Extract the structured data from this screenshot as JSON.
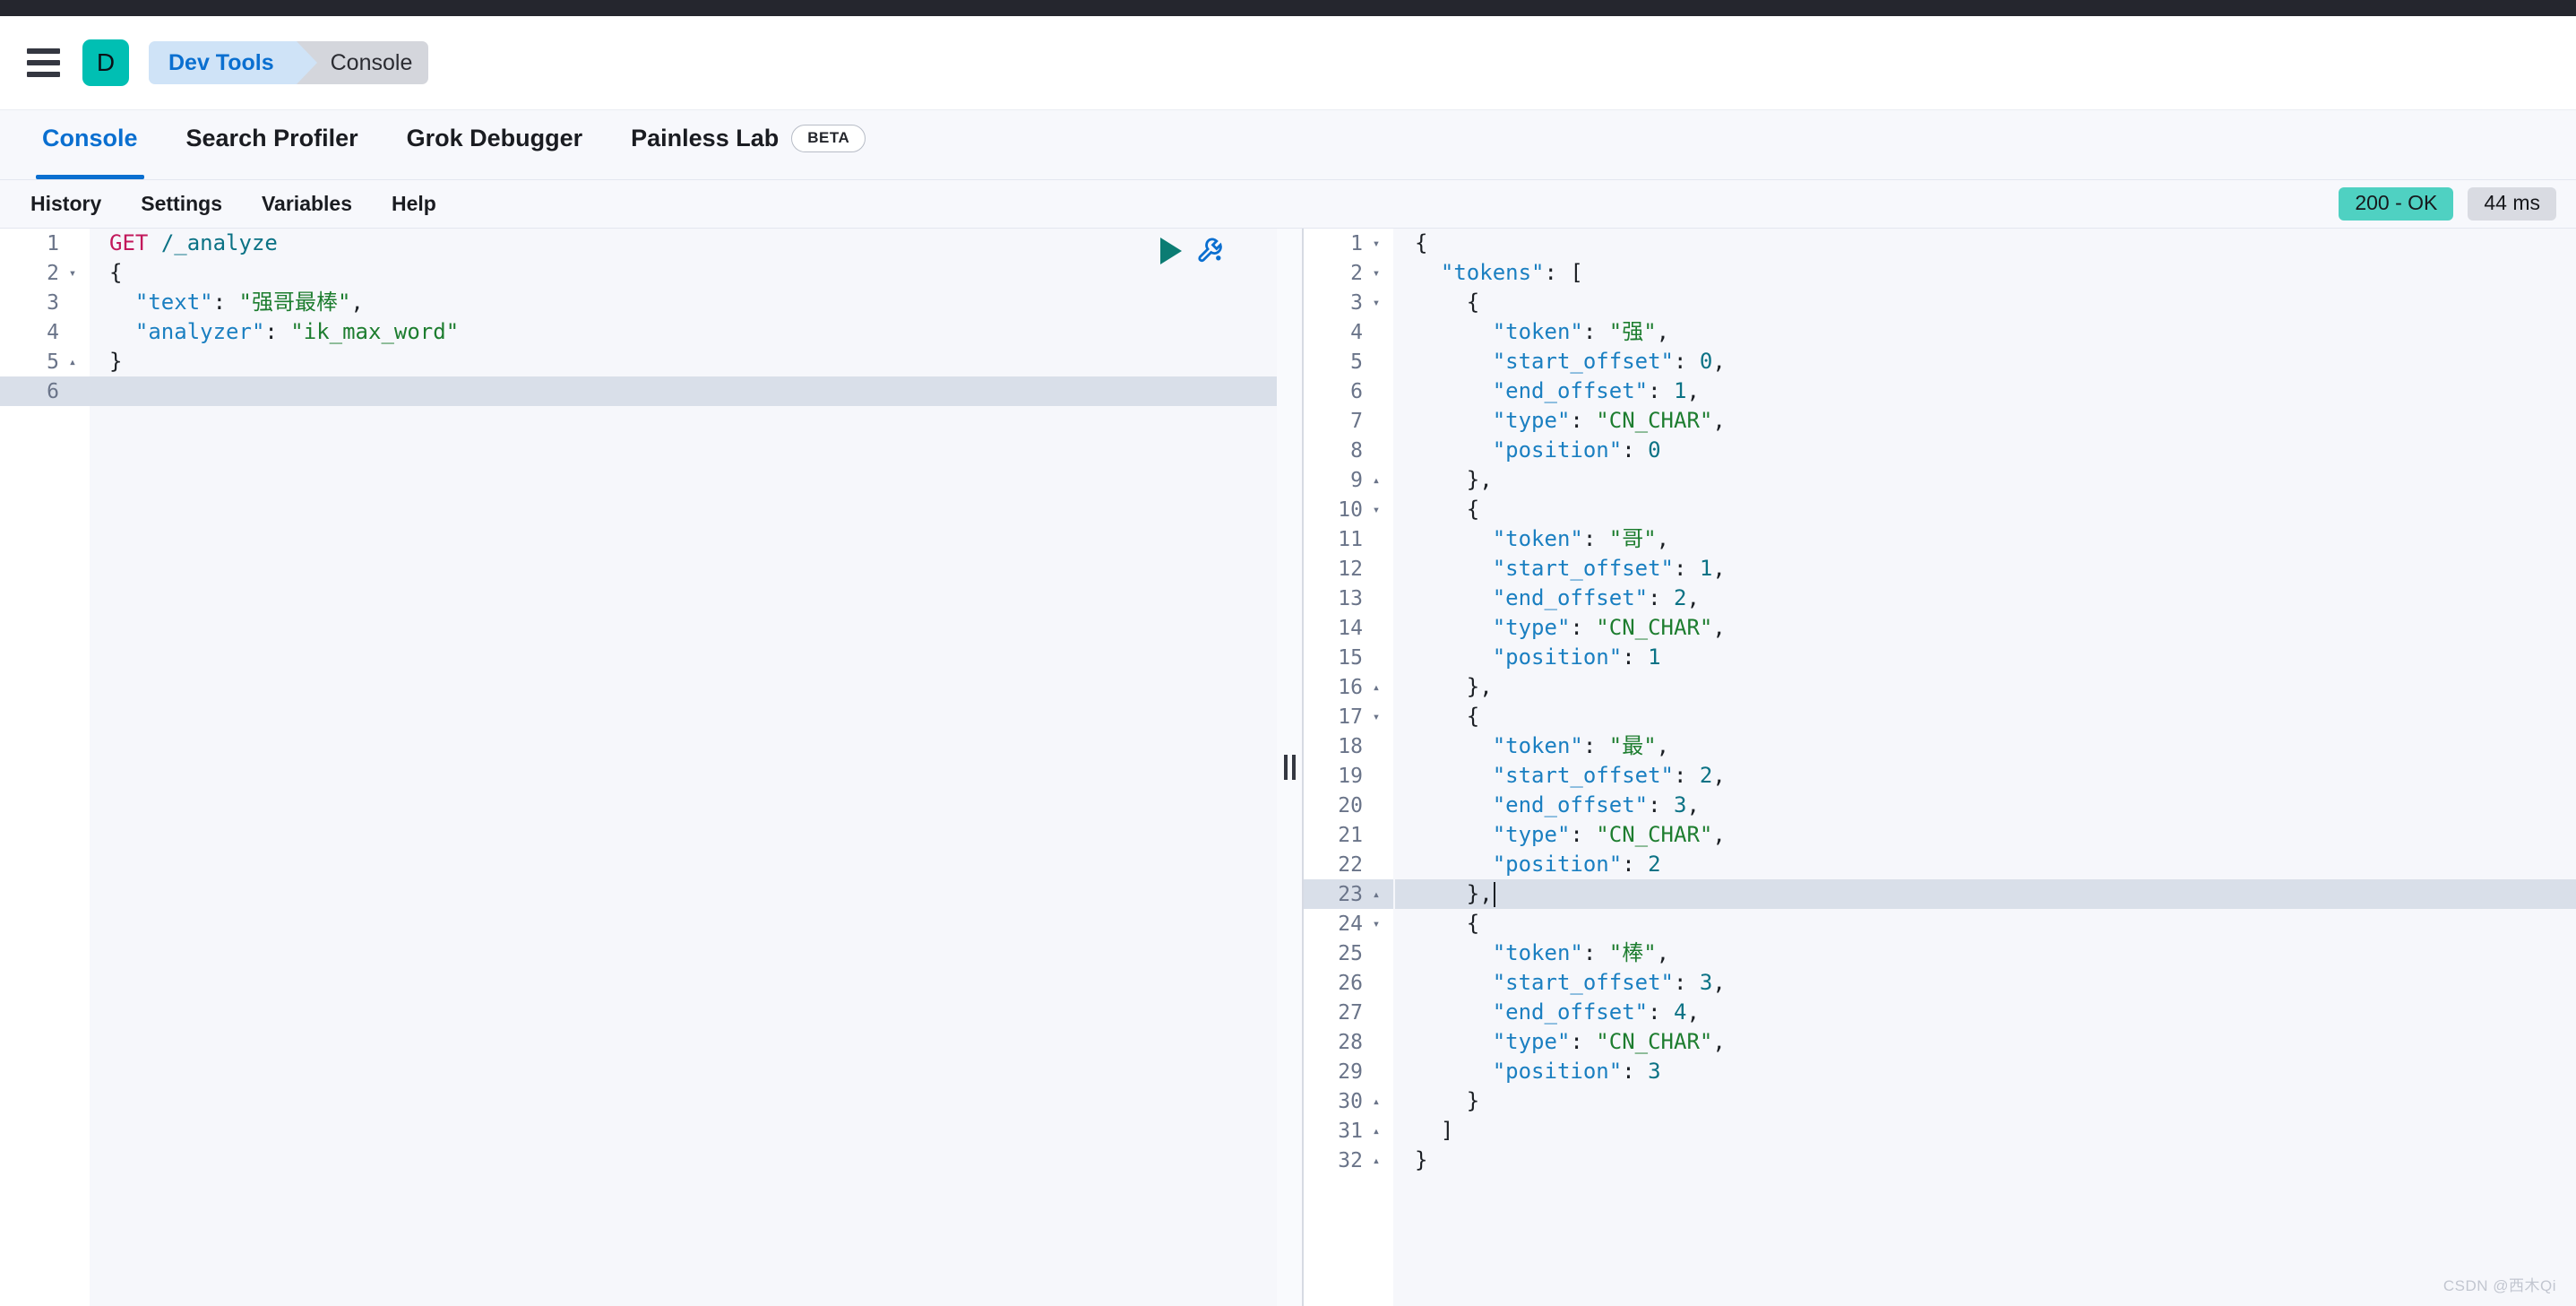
{
  "header": {
    "menu_icon": "hamburger-icon",
    "space_initial": "D",
    "breadcrumbs": [
      "Dev Tools",
      "Console"
    ]
  },
  "app_tabs": [
    {
      "label": "Console",
      "active": true,
      "badge": null
    },
    {
      "label": "Search Profiler",
      "active": false,
      "badge": null
    },
    {
      "label": "Grok Debugger",
      "active": false,
      "badge": null
    },
    {
      "label": "Painless Lab",
      "active": false,
      "badge": "BETA"
    }
  ],
  "console_toolbar": {
    "items": [
      "History",
      "Settings",
      "Variables",
      "Help"
    ],
    "status_label": "200 - OK",
    "time_label": "44 ms",
    "status_color": "#4fd1c2",
    "time_color": "#d9dbe2"
  },
  "editor_actions": {
    "play": "play-icon",
    "wrench": "wrench-icon"
  },
  "request_editor": {
    "active_line": 6,
    "lines": [
      {
        "n": 1,
        "fold": "",
        "tokens": [
          {
            "c": "t-method",
            "t": "GET"
          },
          {
            "c": "t-punc",
            "t": " "
          },
          {
            "c": "t-url",
            "t": "/_analyze"
          }
        ]
      },
      {
        "n": 2,
        "fold": "▾",
        "tokens": [
          {
            "c": "t-punc",
            "t": "{"
          }
        ]
      },
      {
        "n": 3,
        "fold": "",
        "tokens": [
          {
            "c": "t-key",
            "t": "  \"text\""
          },
          {
            "c": "t-punc",
            "t": ": "
          },
          {
            "c": "t-str",
            "t": "\"强哥最棒\""
          },
          {
            "c": "t-punc",
            "t": ","
          }
        ]
      },
      {
        "n": 4,
        "fold": "",
        "tokens": [
          {
            "c": "t-key",
            "t": "  \"analyzer\""
          },
          {
            "c": "t-punc",
            "t": ": "
          },
          {
            "c": "t-str",
            "t": "\"ik_max_word\""
          }
        ]
      },
      {
        "n": 5,
        "fold": "▴",
        "tokens": [
          {
            "c": "t-punc",
            "t": "}"
          }
        ]
      },
      {
        "n": 6,
        "fold": "",
        "tokens": []
      }
    ]
  },
  "response_editor": {
    "active_line": 23,
    "lines": [
      {
        "n": 1,
        "fold": "▾",
        "tokens": [
          {
            "c": "t-punc",
            "t": "{"
          }
        ]
      },
      {
        "n": 2,
        "fold": "▾",
        "tokens": [
          {
            "c": "t-key",
            "t": "  \"tokens\""
          },
          {
            "c": "t-punc",
            "t": ": ["
          }
        ]
      },
      {
        "n": 3,
        "fold": "▾",
        "tokens": [
          {
            "c": "t-punc",
            "t": "    {"
          }
        ]
      },
      {
        "n": 4,
        "fold": "",
        "tokens": [
          {
            "c": "t-key",
            "t": "      \"token\""
          },
          {
            "c": "t-punc",
            "t": ": "
          },
          {
            "c": "t-str",
            "t": "\"强\""
          },
          {
            "c": "t-punc",
            "t": ","
          }
        ]
      },
      {
        "n": 5,
        "fold": "",
        "tokens": [
          {
            "c": "t-key",
            "t": "      \"start_offset\""
          },
          {
            "c": "t-punc",
            "t": ": "
          },
          {
            "c": "t-num",
            "t": "0"
          },
          {
            "c": "t-punc",
            "t": ","
          }
        ]
      },
      {
        "n": 6,
        "fold": "",
        "tokens": [
          {
            "c": "t-key",
            "t": "      \"end_offset\""
          },
          {
            "c": "t-punc",
            "t": ": "
          },
          {
            "c": "t-num",
            "t": "1"
          },
          {
            "c": "t-punc",
            "t": ","
          }
        ]
      },
      {
        "n": 7,
        "fold": "",
        "tokens": [
          {
            "c": "t-key",
            "t": "      \"type\""
          },
          {
            "c": "t-punc",
            "t": ": "
          },
          {
            "c": "t-str",
            "t": "\"CN_CHAR\""
          },
          {
            "c": "t-punc",
            "t": ","
          }
        ]
      },
      {
        "n": 8,
        "fold": "",
        "tokens": [
          {
            "c": "t-key",
            "t": "      \"position\""
          },
          {
            "c": "t-punc",
            "t": ": "
          },
          {
            "c": "t-num",
            "t": "0"
          }
        ]
      },
      {
        "n": 9,
        "fold": "▴",
        "tokens": [
          {
            "c": "t-punc",
            "t": "    },"
          }
        ]
      },
      {
        "n": 10,
        "fold": "▾",
        "tokens": [
          {
            "c": "t-punc",
            "t": "    {"
          }
        ]
      },
      {
        "n": 11,
        "fold": "",
        "tokens": [
          {
            "c": "t-key",
            "t": "      \"token\""
          },
          {
            "c": "t-punc",
            "t": ": "
          },
          {
            "c": "t-str",
            "t": "\"哥\""
          },
          {
            "c": "t-punc",
            "t": ","
          }
        ]
      },
      {
        "n": 12,
        "fold": "",
        "tokens": [
          {
            "c": "t-key",
            "t": "      \"start_offset\""
          },
          {
            "c": "t-punc",
            "t": ": "
          },
          {
            "c": "t-num",
            "t": "1"
          },
          {
            "c": "t-punc",
            "t": ","
          }
        ]
      },
      {
        "n": 13,
        "fold": "",
        "tokens": [
          {
            "c": "t-key",
            "t": "      \"end_offset\""
          },
          {
            "c": "t-punc",
            "t": ": "
          },
          {
            "c": "t-num",
            "t": "2"
          },
          {
            "c": "t-punc",
            "t": ","
          }
        ]
      },
      {
        "n": 14,
        "fold": "",
        "tokens": [
          {
            "c": "t-key",
            "t": "      \"type\""
          },
          {
            "c": "t-punc",
            "t": ": "
          },
          {
            "c": "t-str",
            "t": "\"CN_CHAR\""
          },
          {
            "c": "t-punc",
            "t": ","
          }
        ]
      },
      {
        "n": 15,
        "fold": "",
        "tokens": [
          {
            "c": "t-key",
            "t": "      \"position\""
          },
          {
            "c": "t-punc",
            "t": ": "
          },
          {
            "c": "t-num",
            "t": "1"
          }
        ]
      },
      {
        "n": 16,
        "fold": "▴",
        "tokens": [
          {
            "c": "t-punc",
            "t": "    },"
          }
        ]
      },
      {
        "n": 17,
        "fold": "▾",
        "tokens": [
          {
            "c": "t-punc",
            "t": "    {"
          }
        ]
      },
      {
        "n": 18,
        "fold": "",
        "tokens": [
          {
            "c": "t-key",
            "t": "      \"token\""
          },
          {
            "c": "t-punc",
            "t": ": "
          },
          {
            "c": "t-str",
            "t": "\"最\""
          },
          {
            "c": "t-punc",
            "t": ","
          }
        ]
      },
      {
        "n": 19,
        "fold": "",
        "tokens": [
          {
            "c": "t-key",
            "t": "      \"start_offset\""
          },
          {
            "c": "t-punc",
            "t": ": "
          },
          {
            "c": "t-num",
            "t": "2"
          },
          {
            "c": "t-punc",
            "t": ","
          }
        ]
      },
      {
        "n": 20,
        "fold": "",
        "tokens": [
          {
            "c": "t-key",
            "t": "      \"end_offset\""
          },
          {
            "c": "t-punc",
            "t": ": "
          },
          {
            "c": "t-num",
            "t": "3"
          },
          {
            "c": "t-punc",
            "t": ","
          }
        ]
      },
      {
        "n": 21,
        "fold": "",
        "tokens": [
          {
            "c": "t-key",
            "t": "      \"type\""
          },
          {
            "c": "t-punc",
            "t": ": "
          },
          {
            "c": "t-str",
            "t": "\"CN_CHAR\""
          },
          {
            "c": "t-punc",
            "t": ","
          }
        ]
      },
      {
        "n": 22,
        "fold": "",
        "tokens": [
          {
            "c": "t-key",
            "t": "      \"position\""
          },
          {
            "c": "t-punc",
            "t": ": "
          },
          {
            "c": "t-num",
            "t": "2"
          }
        ]
      },
      {
        "n": 23,
        "fold": "▴",
        "tokens": [
          {
            "c": "t-punc",
            "t": "    },"
          }
        ]
      },
      {
        "n": 24,
        "fold": "▾",
        "tokens": [
          {
            "c": "t-punc",
            "t": "    {"
          }
        ]
      },
      {
        "n": 25,
        "fold": "",
        "tokens": [
          {
            "c": "t-key",
            "t": "      \"token\""
          },
          {
            "c": "t-punc",
            "t": ": "
          },
          {
            "c": "t-str",
            "t": "\"棒\""
          },
          {
            "c": "t-punc",
            "t": ","
          }
        ]
      },
      {
        "n": 26,
        "fold": "",
        "tokens": [
          {
            "c": "t-key",
            "t": "      \"start_offset\""
          },
          {
            "c": "t-punc",
            "t": ": "
          },
          {
            "c": "t-num",
            "t": "3"
          },
          {
            "c": "t-punc",
            "t": ","
          }
        ]
      },
      {
        "n": 27,
        "fold": "",
        "tokens": [
          {
            "c": "t-key",
            "t": "      \"end_offset\""
          },
          {
            "c": "t-punc",
            "t": ": "
          },
          {
            "c": "t-num",
            "t": "4"
          },
          {
            "c": "t-punc",
            "t": ","
          }
        ]
      },
      {
        "n": 28,
        "fold": "",
        "tokens": [
          {
            "c": "t-key",
            "t": "      \"type\""
          },
          {
            "c": "t-punc",
            "t": ": "
          },
          {
            "c": "t-str",
            "t": "\"CN_CHAR\""
          },
          {
            "c": "t-punc",
            "t": ","
          }
        ]
      },
      {
        "n": 29,
        "fold": "",
        "tokens": [
          {
            "c": "t-key",
            "t": "      \"position\""
          },
          {
            "c": "t-punc",
            "t": ": "
          },
          {
            "c": "t-num",
            "t": "3"
          }
        ]
      },
      {
        "n": 30,
        "fold": "▴",
        "tokens": [
          {
            "c": "t-punc",
            "t": "    }"
          }
        ]
      },
      {
        "n": 31,
        "fold": "▴",
        "tokens": [
          {
            "c": "t-punc",
            "t": "  ]"
          }
        ]
      },
      {
        "n": 32,
        "fold": "▴",
        "tokens": [
          {
            "c": "t-punc",
            "t": "}"
          }
        ]
      }
    ]
  },
  "watermark": "CSDN @西木Qi"
}
